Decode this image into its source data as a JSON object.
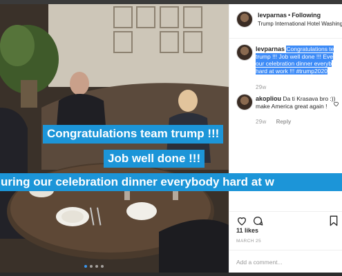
{
  "post": {
    "username": "levparnas",
    "separator": "•",
    "follow_status": "Following",
    "location": "Trump International Hotel Washington",
    "caption_prefix_user": "levparnas",
    "caption_line1": "Congratulations te",
    "caption_line2": "trump !!! Job well done !!! Eve",
    "caption_line3": "our celebration dinner everyb",
    "caption_line4": "hard at work !!! #trump2020",
    "caption_time": "29w",
    "likes": "11 likes",
    "date": "MARCH 25",
    "add_comment_placeholder": "Add a comment..."
  },
  "comments": [
    {
      "username": "akopliou",
      "text": "Da ti Krasava bro :))",
      "text_line2": "make America great again !",
      "time": "29w",
      "reply_label": "Reply"
    }
  ],
  "carousel": {
    "count": 4,
    "active_index": 0
  },
  "overlay_captions": {
    "line1": "Congratulations team trump !!!",
    "line2": "Job well done !!!",
    "line3": "uring our celebration dinner everybody hard at w"
  },
  "colors": {
    "caption_bar": "#1c95d8",
    "text_highlight": "#3d8bf7",
    "muted_text": "#999999",
    "active_dot": "#3a97f0"
  },
  "icons": [
    "heart-icon",
    "comment-icon",
    "bookmark-icon",
    "heart-small-icon"
  ]
}
